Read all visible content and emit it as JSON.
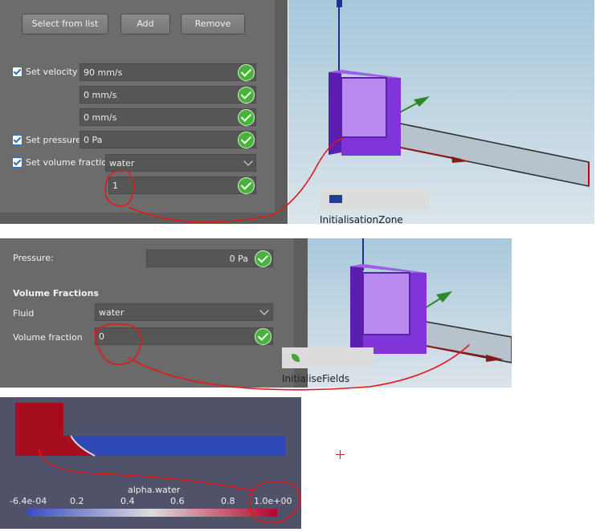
{
  "top_panel": {
    "buttons": {
      "select": "Select from list",
      "add": "Add",
      "remove": "Remove"
    },
    "velocity": {
      "label": "Set velocity",
      "x": "90 mm/s",
      "y": "0 mm/s",
      "z": "0 mm/s"
    },
    "pressure": {
      "label": "Set pressure",
      "value": "0 Pa"
    },
    "volume_fractions": {
      "label": "Set volume fractions",
      "fluid": "water",
      "value": "1"
    },
    "tooltip": "InitialisationZone"
  },
  "middle_panel": {
    "pressure": {
      "label": "Pressure:",
      "value": "0 Pa"
    },
    "section_title": "Volume Fractions",
    "fluid": {
      "label": "Fluid",
      "value": "water"
    },
    "volume_fraction": {
      "label": "Volume fraction",
      "value": "0"
    },
    "tooltip": "InitialiseFields"
  },
  "paraview": {
    "colorbar_title": "alpha.water",
    "ticks": [
      "-6.4e-04",
      "0.2",
      "0.4",
      "0.6",
      "0.8",
      "1.0e+00"
    ]
  },
  "colors": {
    "annotation": "#e01919",
    "ok_green": "#48b33a",
    "box_purple": "#8a3fd6"
  }
}
